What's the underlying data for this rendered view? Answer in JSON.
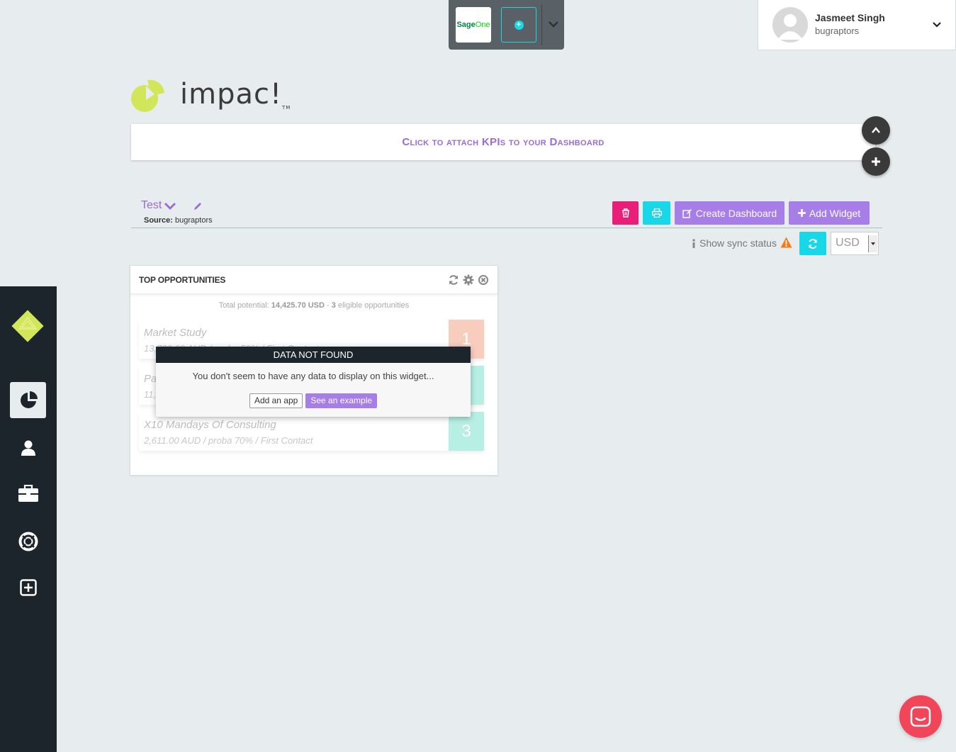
{
  "app_switcher": {
    "apps": [
      {
        "name_part1": "Sage",
        "name_part2": "One"
      }
    ]
  },
  "user": {
    "name": "Jasmeet Singh",
    "organization": "bugraptors"
  },
  "logo": {
    "text": "impac!",
    "tm": "TM"
  },
  "kpi_bar": {
    "text": "Click to attach KPIs to your Dashboard"
  },
  "dashboard": {
    "name": "Test",
    "source_label": "Source:",
    "source_value": "bugraptors",
    "buttons": {
      "create": "Create Dashboard",
      "add_widget": "Add Widget"
    },
    "sync_status": "Show sync status",
    "currency": "USD"
  },
  "widget": {
    "title": "TOP OPPORTUNITIES",
    "summary_prefix": "Total potential:",
    "summary_amount": "14,425.70 USD",
    "summary_sep": "-",
    "summary_count": "3",
    "summary_suffix": "eligible opportunities",
    "opportunities": [
      {
        "name": "Market Study",
        "detail": "13,720.00 AUD / proba 50% / First Contact",
        "rank": "1",
        "color": "#f4a58a"
      },
      {
        "name": "Pa",
        "detail": "11,",
        "rank": "2",
        "color": "#7ee3cf"
      },
      {
        "name": "X10 Mandays Of Consulting",
        "detail": "2,611.00 AUD / proba 70% / First Contact",
        "rank": "3",
        "color": "#7ee3cf"
      }
    ]
  },
  "modal": {
    "title": "DATA NOT FOUND",
    "message": "You don't seem to have any data to display on this widget...",
    "add_app": "Add an app",
    "see_example": "See an example"
  },
  "colors": {
    "accent_purple": "#a77ee8",
    "accent_cyan": "#18d7e8",
    "danger_pink": "#e91e78",
    "sidebar_bg": "#1b252b",
    "logo_lime": "#d2e65a"
  }
}
